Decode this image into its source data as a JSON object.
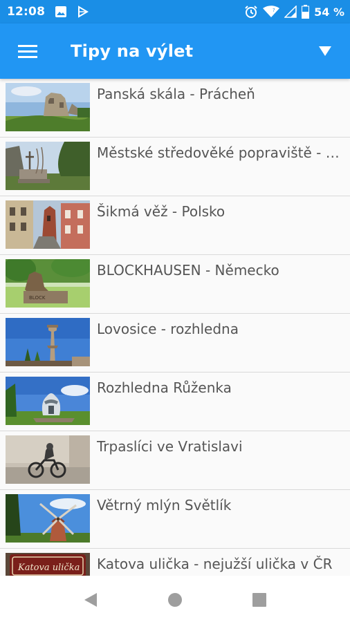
{
  "status_bar": {
    "time": "12:08",
    "battery": "54 %",
    "icons": [
      "image-icon",
      "play-store-icon",
      "alarm-icon",
      "wifi-icon",
      "signal-icon",
      "battery-icon"
    ]
  },
  "app_bar": {
    "title": "Tipy na výlet",
    "menu_icon": "hamburger-menu-icon",
    "dropdown_icon": "dropdown-triangle-icon"
  },
  "trips": [
    {
      "title": "Panská skála - Prácheň",
      "thumbnail": "castle-ruins-photo"
    },
    {
      "title": "Městské středověké popraviště - Loket",
      "thumbnail": "gallows-stone-photo"
    },
    {
      "title": "Šikmá věž - Polsko",
      "thumbnail": "leaning-tower-street-photo"
    },
    {
      "title": "BLOCKHAUSEN - Německo",
      "thumbnail": "wood-sculpture-photo"
    },
    {
      "title": "Lovosice - rozhledna",
      "thumbnail": "lookout-tower-photo"
    },
    {
      "title": "Rozhledna Růženka",
      "thumbnail": "ruzenka-tower-photo"
    },
    {
      "title": "Trpaslíci ve Vratislavi",
      "thumbnail": "dwarf-statue-photo"
    },
    {
      "title": "Větrný mlýn Světlík",
      "thumbnail": "windmill-photo"
    },
    {
      "title": "Katova ulička - nejužší ulička v ČR",
      "thumbnail": "katova-ulicka-sign-photo"
    }
  ],
  "nav_bar": {
    "back_icon": "back-triangle-icon",
    "home_icon": "home-circle-icon",
    "recents_icon": "recents-square-icon"
  },
  "colors": {
    "status_bar": "#1a8ee6",
    "app_bar": "#2196f3",
    "list_background": "#fafafa",
    "item_text": "#555555",
    "divider": "#d9d9d9"
  }
}
